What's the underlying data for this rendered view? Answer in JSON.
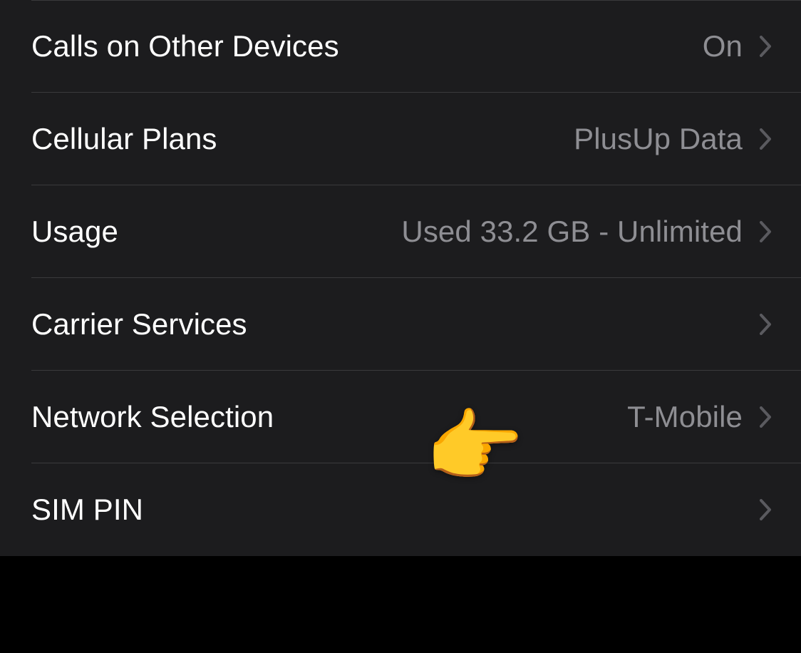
{
  "rows": [
    {
      "label": "Calls on Other Devices",
      "value": "On"
    },
    {
      "label": "Cellular Plans",
      "value": "PlusUp Data"
    },
    {
      "label": "Usage",
      "value": "Used 33.2 GB - Unlimited"
    },
    {
      "label": "Carrier Services",
      "value": ""
    },
    {
      "label": "Network Selection",
      "value": "T-Mobile"
    },
    {
      "label": "SIM PIN",
      "value": ""
    }
  ],
  "annotation": {
    "glyph": "👉"
  }
}
